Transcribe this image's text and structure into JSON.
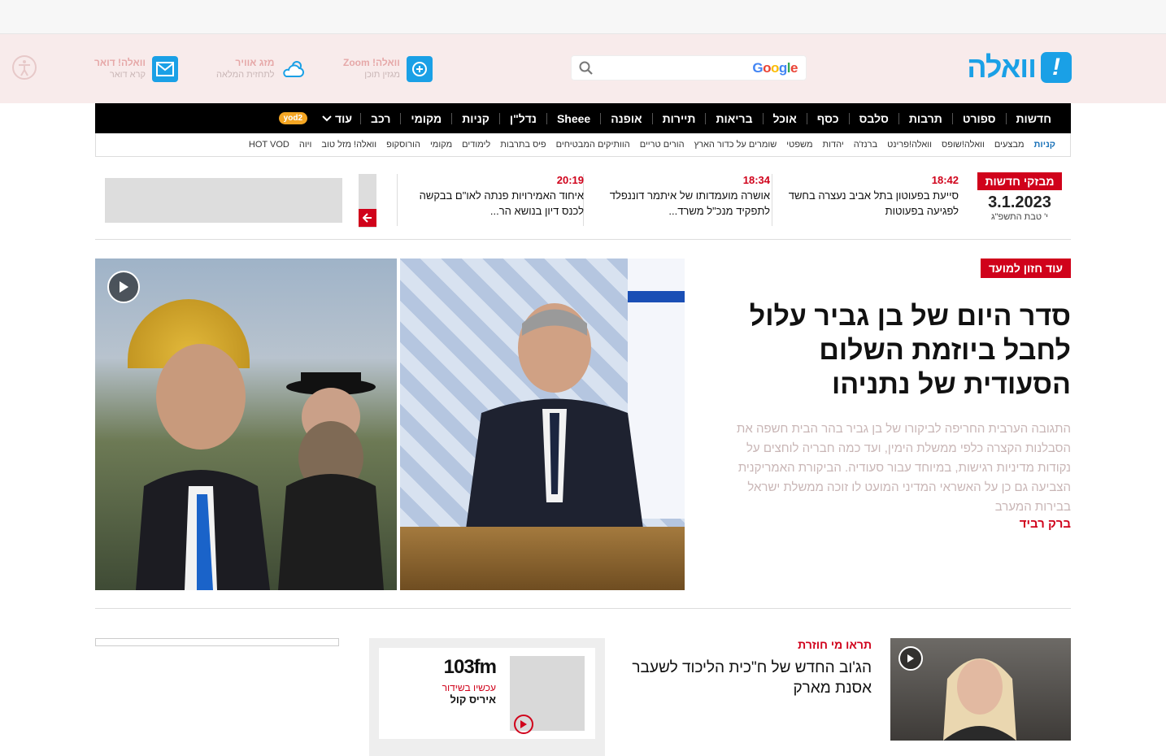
{
  "header": {
    "logo_text": "וואלה",
    "logo_mark": "!",
    "search": {
      "placeholder": "",
      "provider": "Google"
    },
    "zoom": {
      "title": "וואלה! Zoom",
      "subtitle": "מגזין תוכן"
    },
    "weather": {
      "title": "מזג אוויר",
      "subtitle": "לתחזית המלאה"
    },
    "mail": {
      "title": "וואלה! דואר",
      "subtitle": "קרא דואר"
    }
  },
  "nav": {
    "items": [
      "חדשות",
      "ספורט",
      "תרבות",
      "סלבס",
      "כסף",
      "אוכל",
      "בריאות",
      "תיירות",
      "אופנה",
      "Sheee",
      "נדל\"ן",
      "קניות",
      "מקומי",
      "רכב"
    ],
    "more_label": "עוד",
    "badge": "yod2"
  },
  "subnav": {
    "items": [
      "קניות",
      "מבצעים",
      "וואלה!שופס",
      "וואלה!פרינט",
      "ברנז'ה",
      "יהדות",
      "משפטי",
      "שומרים על כדור הארץ",
      "הורים טריים",
      "הוותיקים המבטיחים",
      "פיס בתרבות",
      "לימודים",
      "מקומי",
      "הורוסקופ",
      "וואלה! מזל טוב",
      "ויוה",
      "HOT VOD"
    ]
  },
  "breaking": {
    "label": "מבזקי חדשות",
    "date": "3.1.2023",
    "hebrew_date": "י' טבת התשפ\"ג",
    "items": [
      {
        "time": "18:42",
        "text": "סייעת בפעוטון בתל אביב נעצרה בחשד לפגיעה בפעוטות"
      },
      {
        "time": "18:34",
        "text": "אושרה מועמדותו של איתמר דוננפלד לתפקיד מנכ\"ל משרד..."
      },
      {
        "time": "20:19",
        "text": "איחוד האמירויות פנתה לאו\"ם בבקשה לכנס דיון בנושא הר..."
      }
    ]
  },
  "hero": {
    "tag": "עוד חזון למועד",
    "title": "סדר היום של בן גביר עלול לחבל ביוזמת השלום הסעודית של נתניהו",
    "summary": "התגובה הערבית החריפה לביקורו של בן גביר בהר הבית חשפה את הסבלנות הקצרה כלפי ממשלת הימין, ועד כמה חבריה לוחצים על נקודות מדיניות רגישות, במיוחד עבור סעודיה. הביקורת האמריקנית הצביעה גם כן על האשראי המדיני המועט לו זוכה ממשלת ישראל בבירות המערב",
    "author": "ברק רביד"
  },
  "card": {
    "tag": "תראו מי חוזרת",
    "title": "הג'וב החדש של ח\"כית הליכוד לשעבר אסנת מארק"
  },
  "radio": {
    "logo": "103fm",
    "live": "עכשיו בשידור",
    "host": "איריס קול"
  },
  "colors": {
    "accent": "#d0021b",
    "brand": "#1aa0e6",
    "nav_bg": "#000000"
  }
}
